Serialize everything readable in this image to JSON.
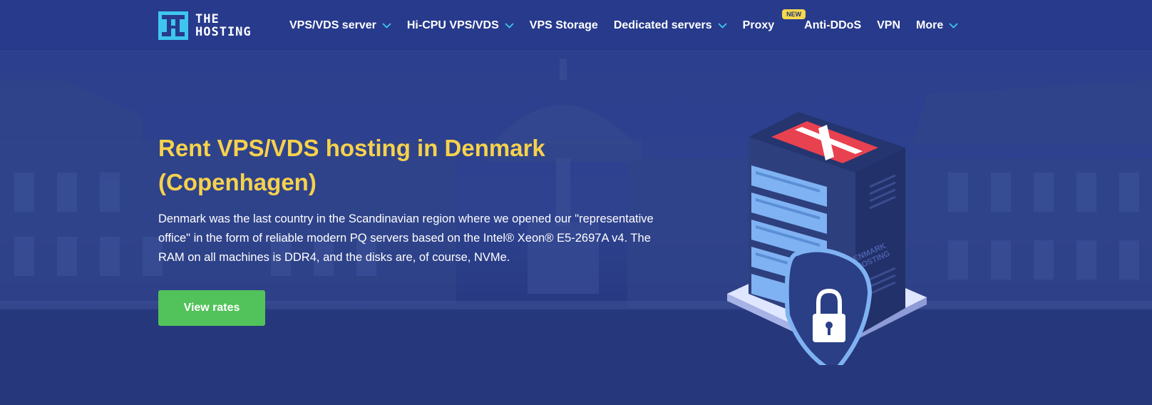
{
  "header": {
    "logo": {
      "line1": "THE",
      "line2": "HOSTING"
    },
    "nav": [
      {
        "label": "VPS/VDS server",
        "has_dropdown": true
      },
      {
        "label": "Hi-CPU VPS/VDS",
        "has_dropdown": true
      },
      {
        "label": "VPS Storage",
        "has_dropdown": false
      },
      {
        "label": "Dedicated servers",
        "has_dropdown": true
      },
      {
        "label": "Proxy",
        "has_dropdown": false,
        "badge": "NEW"
      },
      {
        "label": "Anti-DDoS",
        "has_dropdown": false
      },
      {
        "label": "VPN",
        "has_dropdown": false
      },
      {
        "label": "More",
        "has_dropdown": true
      }
    ]
  },
  "hero": {
    "title": "Rent VPS/VDS hosting in Denmark (Copenhagen)",
    "description": "Denmark was the last country in the Scandinavian region where we opened our \"representative office\" in the form of reliable modern PQ servers based on the Intel® Xeon® E5-2697A v4. The RAM on all machines is DDR4, and the disks are, of course, NVMe.",
    "cta_label": "View rates",
    "server_label_line1": "DENMARK",
    "server_label_line2": "PQ.HOSTING"
  },
  "colors": {
    "header_bg": "#273a8c",
    "hero_bg": "#2b3f8e",
    "title": "#f6d24c",
    "cta": "#52c25a",
    "badge": "#f5d94a",
    "accent_cyan": "#3fc6ee",
    "flag_red": "#e8414f"
  },
  "icons": [
    "logo-mark-icon",
    "chevron-down-icon",
    "shield-icon",
    "padlock-icon"
  ]
}
